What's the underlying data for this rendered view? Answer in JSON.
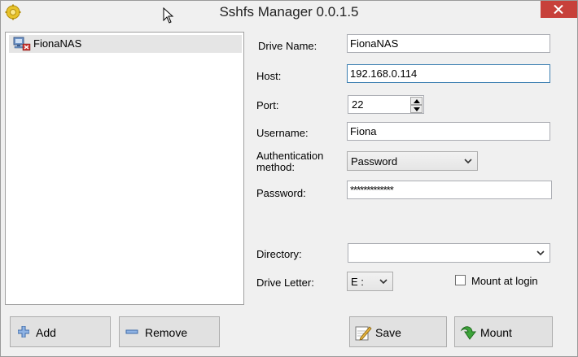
{
  "window": {
    "title": "Sshfs Manager 0.0.1.5"
  },
  "connections": [
    {
      "name": "FionaNAS",
      "icon": "network-drive-disconnected-icon"
    }
  ],
  "form": {
    "drive_name": {
      "label": "Drive Name:",
      "value": "FionaNAS"
    },
    "host": {
      "label": "Host:",
      "value": "192.168.0.114"
    },
    "port": {
      "label": "Port:",
      "value": "22"
    },
    "username": {
      "label": "Username:",
      "value": "Fiona"
    },
    "auth_method": {
      "label": "Authentication method:",
      "value": "Password"
    },
    "password": {
      "label": "Password:",
      "value": "*************"
    },
    "directory": {
      "label": "Directory:",
      "value": ""
    },
    "drive_letter": {
      "label": "Drive Letter:",
      "value": "E :"
    },
    "mount_at_login": {
      "label": "Mount at login",
      "checked": false
    }
  },
  "buttons": {
    "add": "Add",
    "remove": "Remove",
    "save": "Save",
    "mount": "Mount"
  },
  "colors": {
    "close_button": "#c7403a",
    "focus_border": "#3c7fb1",
    "selection": "#e5e5e5"
  }
}
